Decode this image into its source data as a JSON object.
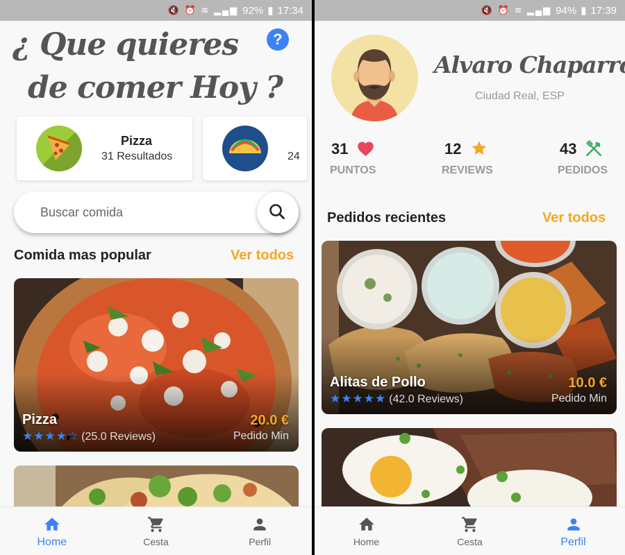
{
  "left": {
    "status": {
      "battery": "92%",
      "time": "17:34"
    },
    "title_line1": "¿ Que quieres",
    "title_line2": "de comer Hoy ?",
    "categories": [
      {
        "name": "Pizza",
        "count": "31 Resultados"
      },
      {
        "name": "",
        "count": "24"
      }
    ],
    "search": {
      "placeholder": "Buscar comida"
    },
    "section_title": "Comida mas popular",
    "see_all": "Ver todos",
    "cards": [
      {
        "name": "Pizza",
        "stars": "★★★★☆",
        "rating": 4,
        "reviews": "(25.0 Reviews)",
        "price": "20.0 €",
        "min_label": "Pedido Min"
      }
    ],
    "nav": {
      "home": "Home",
      "cart": "Cesta",
      "profile": "Perfil",
      "active": "home"
    }
  },
  "right": {
    "status": {
      "battery": "94%",
      "time": "17:39"
    },
    "profile": {
      "name": "Alvaro Chaparro",
      "location": "Ciudad Real, ESP"
    },
    "stats": [
      {
        "value": "31",
        "label": "PUNTOS",
        "icon": "heart-icon"
      },
      {
        "value": "12",
        "label": "REVIEWS",
        "icon": "star-icon"
      },
      {
        "value": "43",
        "label": "PEDIDOS",
        "icon": "utensils-icon"
      }
    ],
    "section_title": "Pedidos recientes",
    "see_all": "Ver todos",
    "cards": [
      {
        "name": "Alitas de Pollo",
        "stars": "★★★★★",
        "rating": 5,
        "reviews": "(42.0 Reviews)",
        "price": "10.0 €",
        "min_label": "Pedido Min"
      }
    ],
    "nav": {
      "home": "Home",
      "cart": "Cesta",
      "profile": "Perfil",
      "active": "profile"
    }
  },
  "colors": {
    "accent": "#3b82f6",
    "highlight": "#f5a623",
    "heart": "#e8455f",
    "star": "#f5a623",
    "utensils": "#3dae5c"
  }
}
